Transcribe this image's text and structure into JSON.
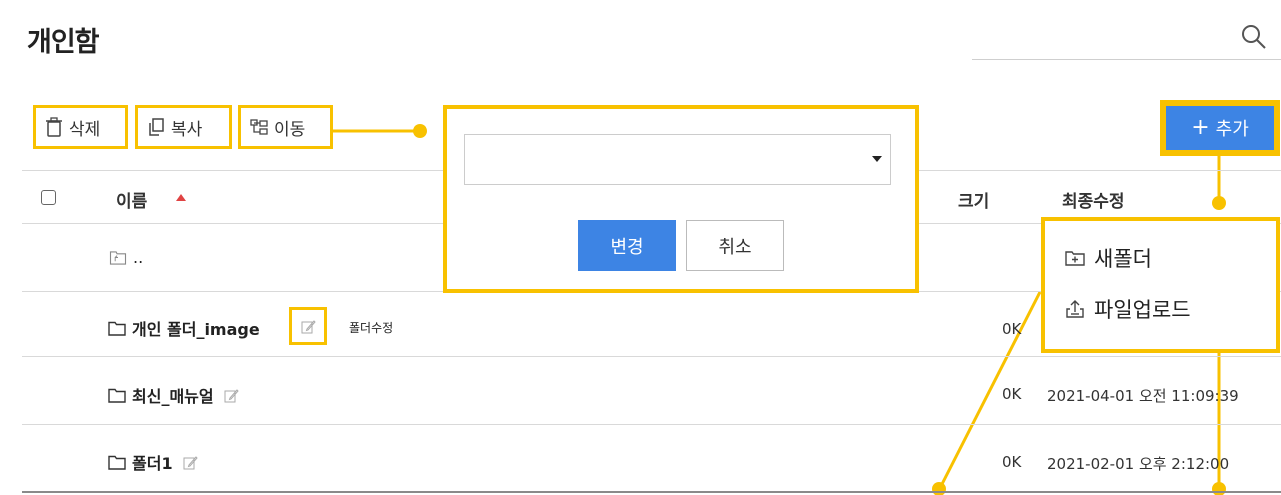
{
  "page": {
    "title": "개인함"
  },
  "search": {
    "icon": "search-icon"
  },
  "toolbar": {
    "delete_label": "삭제",
    "copy_label": "복사",
    "move_label": "이동",
    "add_label": "추가",
    "add_icon": "plus-icon"
  },
  "table": {
    "headers": {
      "name": "이름",
      "size": "크기",
      "modified": "최종수정"
    },
    "parent_label": "..",
    "rows": [
      {
        "name": "개인 폴더_image",
        "size": "0K",
        "modified": ""
      },
      {
        "name": "최신_매뉴얼",
        "size": "0K",
        "modified": "2021-04-01 오전 11:09:39"
      },
      {
        "name": "폴더1",
        "size": "0K",
        "modified": "2021-02-01 오후 2:12:00"
      }
    ]
  },
  "move_dialog": {
    "select_value": "",
    "change_label": "변경",
    "cancel_label": "취소"
  },
  "add_menu": {
    "items": [
      {
        "label": "새폴더",
        "icon": "new-folder-icon"
      },
      {
        "label": "파일업로드",
        "icon": "upload-icon"
      }
    ]
  },
  "annotation": {
    "edit_folder_note": "폴더수정"
  },
  "colors": {
    "highlight": "#f8c100",
    "primary": "#3d84e4",
    "sort_arrow": "#e04343"
  }
}
